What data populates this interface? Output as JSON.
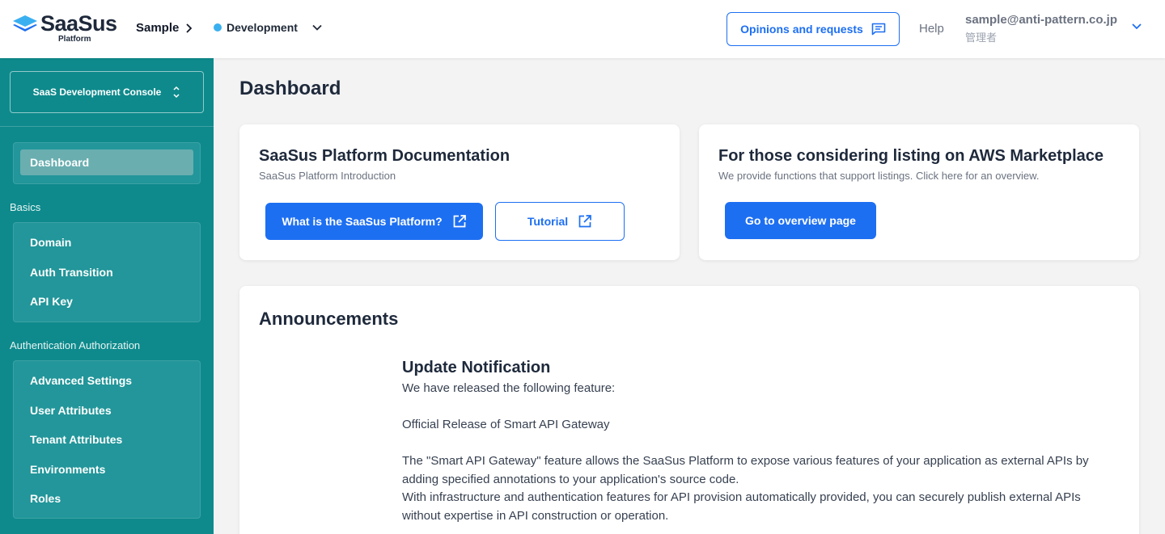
{
  "header": {
    "logo_text": "SaaSus",
    "logo_sub": "Platform",
    "project": "Sample",
    "environment": "Development",
    "environment_color": "#3bb0f0",
    "opinions_label": "Opinions and requests",
    "help_label": "Help",
    "user_email": "sample@anti-pattern.co.jp",
    "user_role": "管理者"
  },
  "sidebar": {
    "console_label": "SaaS Development Console",
    "dashboard_label": "Dashboard",
    "sections": [
      {
        "title": "Basics",
        "items": [
          "Domain",
          "Auth Transition",
          "API Key"
        ]
      },
      {
        "title": "Authentication Authorization",
        "items": [
          "Advanced Settings",
          "User Attributes",
          "Tenant Attributes",
          "Environments",
          "Roles"
        ]
      }
    ]
  },
  "main": {
    "page_title": "Dashboard",
    "docs_card": {
      "title": "SaaSus Platform Documentation",
      "subtitle": "SaaSus Platform Introduction",
      "primary_button": "What is the SaaSus Platform?",
      "secondary_button": "Tutorial"
    },
    "aws_card": {
      "title": "For those considering listing on AWS Marketplace",
      "subtitle": "We provide functions that support listings. Click here for an overview.",
      "button": "Go to overview page"
    },
    "announcements": {
      "title": "Announcements",
      "heading": "Update Notification",
      "p1": "We have released the following feature:",
      "p2": "Official Release of Smart API Gateway",
      "p3": "The \"Smart API Gateway\" feature allows the SaaSus Platform to expose various features of your application as external APIs by adding specified annotations to your application's source code.",
      "p4": "With infrastructure and authentication features for API provision automatically provided, you can securely publish external APIs without expertise in API construction or operation."
    }
  },
  "colors": {
    "sidebar_bg": "#0e8a8c",
    "accent_blue": "#1d6ff2"
  },
  "icons": [
    "saasus-logo-icon",
    "chevron-right-icon",
    "chevron-down-icon",
    "chat-icon",
    "updown-icon",
    "external-link-icon"
  ]
}
